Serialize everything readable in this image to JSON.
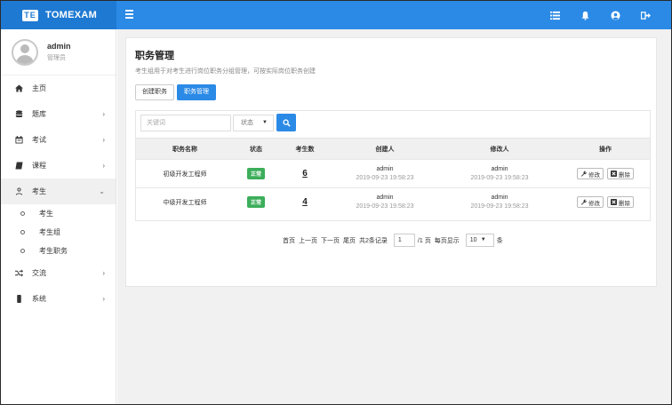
{
  "brand": {
    "logo": "TE",
    "name": "TOMEXAM"
  },
  "topbar": {
    "icons": [
      "list-icon",
      "bell-icon",
      "user-circle-icon",
      "logout-icon"
    ]
  },
  "user": {
    "name": "admin",
    "role": "管理员"
  },
  "sidebar": {
    "items": [
      {
        "label": "主页",
        "icon": "home-icon",
        "chevron": ""
      },
      {
        "label": "题库",
        "icon": "database-icon",
        "chevron": "›"
      },
      {
        "label": "考试",
        "icon": "calendar-icon",
        "chevron": "›"
      },
      {
        "label": "课程",
        "icon": "book-icon",
        "chevron": "›"
      },
      {
        "label": "考生",
        "icon": "user-icon",
        "chevron": "⌄"
      },
      {
        "label": "交流",
        "icon": "shuffle-icon",
        "chevron": "›"
      },
      {
        "label": "系统",
        "icon": "mobile-icon",
        "chevron": "›"
      }
    ],
    "submenu": [
      "考生",
      "考生组",
      "考生职务"
    ]
  },
  "main": {
    "title": "职务管理",
    "description": "考生组用于对考生进行岗位职务分组管理，可按实际岗位职务创建",
    "tabs": [
      "创建职务",
      "职务管理"
    ],
    "filter": {
      "keyword_placeholder": "关键词",
      "status_label": "状态",
      "status_arrow": "▼"
    },
    "table": {
      "headers": [
        "职务名称",
        "状态",
        "考生数",
        "创建人",
        "修改人",
        "操作"
      ],
      "rows": [
        {
          "name": "初级开发工程师",
          "status": "正常",
          "count": "6",
          "creator": "admin",
          "created": "2019-09-23 19:58:23",
          "modifier": "admin",
          "modified": "2019-09-23 19:58:23",
          "edit": "修改",
          "delete": "删除"
        },
        {
          "name": "中级开发工程师",
          "status": "正常",
          "count": "4",
          "creator": "admin",
          "created": "2019-09-23 19:58:23",
          "modifier": "admin",
          "modified": "2019-09-23 19:58:23",
          "edit": "修改",
          "delete": "删除"
        }
      ]
    },
    "pager": {
      "first": "首页",
      "prev": "上一页",
      "next": "下一页",
      "last": "尾页",
      "total": "共2条记录",
      "page": "1",
      "page_total": "/1 页",
      "per_page_label": "每页显示",
      "per_page": "10",
      "per_page_unit": "条"
    }
  },
  "colors": {
    "primary": "#2b8ae6",
    "success": "#3cae5a"
  }
}
